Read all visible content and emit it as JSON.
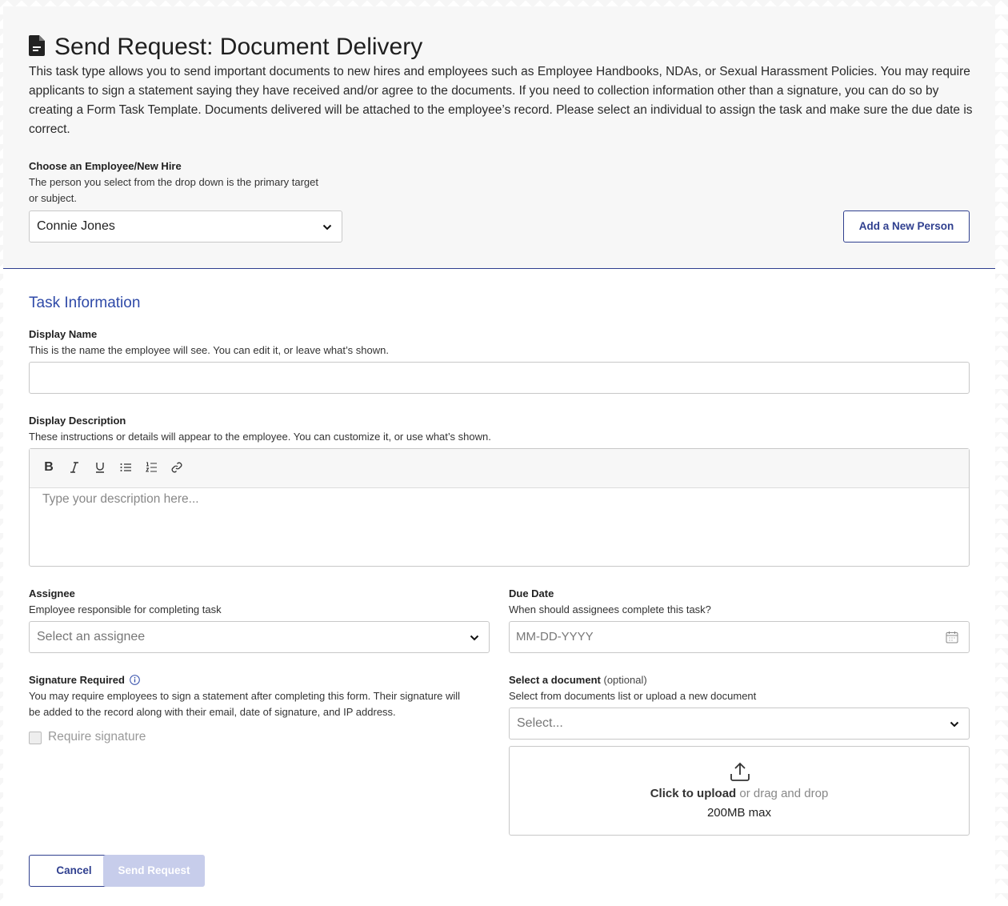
{
  "header": {
    "title": "Send Request: Document Delivery",
    "intro": "This task type allows you to send important documents to new hires and employees such as Employee Handbooks, NDAs, or Sexual Harassment Policies. You may require applicants to sign a statement saying they have received and/or agree to the documents. If you need to collection information other than a signature, you can do so by creating a Form Task Template. Documents delivered will be attached to the employee’s record. Please select an individual to assign the task and make sure the due date is correct.",
    "icon": "document-icon"
  },
  "employee": {
    "label": "Choose an Employee/New Hire",
    "help_line1": "The person you select from the drop down is the primary target",
    "help_line2": "or subject.",
    "selected": "Connie Jones",
    "add_person": "Add a New Person"
  },
  "task": {
    "section_title": "Task Information",
    "display_name": {
      "label": "Display Name",
      "help": "This is the name the employee will see. You can edit it, or leave what’s shown.",
      "value": ""
    },
    "display_description": {
      "label": "Display Description",
      "help": "These instructions or details will appear to the employee. You can customize it, or use what’s shown.",
      "placeholder": "Type your description here...",
      "toolbar": [
        "bold-icon",
        "italic-icon",
        "underline-icon",
        "bullet-list-icon",
        "numbered-list-icon",
        "link-icon"
      ]
    },
    "assignee": {
      "label": "Assignee",
      "help": "Employee responsible for completing task",
      "placeholder": "Select an assignee"
    },
    "due_date": {
      "label": "Due Date",
      "help": "When should assignees complete this task?",
      "placeholder": "MM-DD-YYYY"
    },
    "signature": {
      "label": "Signature Required",
      "help_line1": "You may require employees to sign a statement after completing this form. Their signature will",
      "help_line2": "be added to the record along with their email, date of signature, and IP address.",
      "checkbox_label": "Require signature",
      "checked": false
    },
    "document": {
      "label": "Select a document",
      "optional": "(optional)",
      "help": "Select from documents list or upload a new document",
      "placeholder": "Select...",
      "upload_strong": "Click to upload",
      "upload_rest": "or drag and drop",
      "upload_max": "200MB max"
    }
  },
  "actions": {
    "cancel": "Cancel",
    "send": "Send Request"
  },
  "colors": {
    "accent": "#2f3f8f",
    "section_title": "#2f4aa8",
    "disabled_button": "#c7cdeb"
  }
}
